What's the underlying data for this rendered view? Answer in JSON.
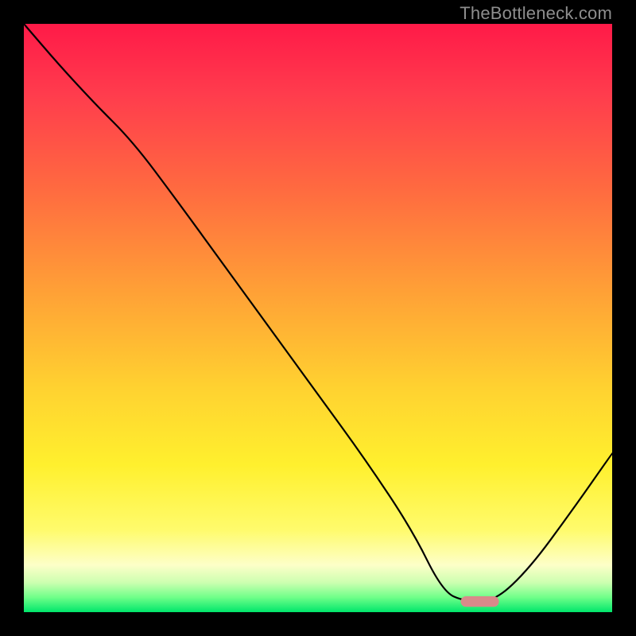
{
  "attribution": "TheBottleneck.com",
  "chart_data": {
    "type": "line",
    "title": "",
    "xlabel": "",
    "ylabel": "",
    "xlim": [
      0,
      1
    ],
    "ylim": [
      0,
      1
    ],
    "annotations": [
      {
        "text": "TheBottleneck.com",
        "position": "top-right"
      }
    ],
    "series": [
      {
        "name": "bottleneck-curve",
        "x": [
          0.0,
          0.06,
          0.12,
          0.185,
          0.26,
          0.34,
          0.42,
          0.5,
          0.58,
          0.66,
          0.712,
          0.75,
          0.8,
          0.86,
          0.93,
          1.0
        ],
        "y": [
          1.0,
          0.93,
          0.865,
          0.8,
          0.7,
          0.59,
          0.48,
          0.37,
          0.26,
          0.14,
          0.035,
          0.018,
          0.018,
          0.075,
          0.17,
          0.27
        ]
      }
    ],
    "marker": {
      "shape": "rounded-rect",
      "color": "#d98a8a",
      "x_center": 0.775,
      "y_center": 0.018,
      "width": 0.065,
      "height": 0.018
    },
    "background_gradient_note": "Vertical gradient red→orange→yellow→green encodes bottleneck severity (top=bad, bottom=good)."
  }
}
